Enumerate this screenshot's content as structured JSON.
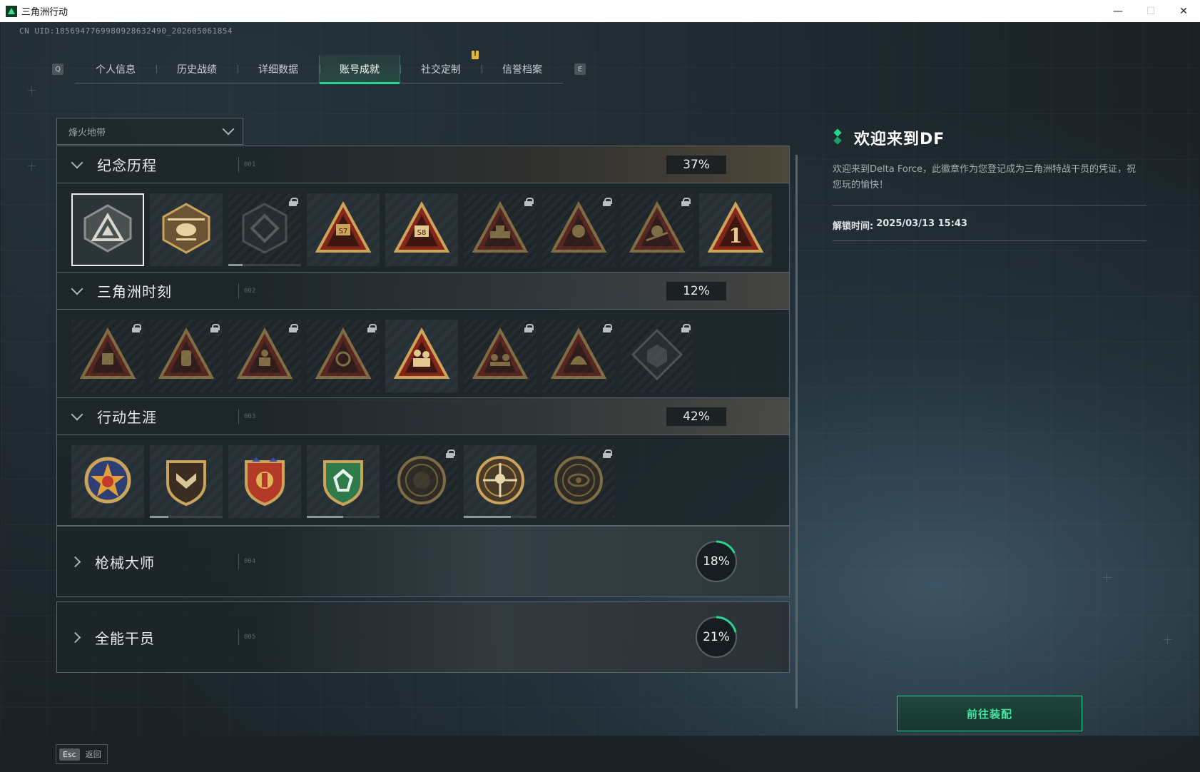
{
  "window": {
    "title": "三角洲行动",
    "minimize": "—",
    "maximize": "☐",
    "close": "✕"
  },
  "uid_text": "CN UID:1856947769980928632490_202605061854",
  "tabs": {
    "left_key": "Q",
    "right_key": "E",
    "items": [
      {
        "label": "个人信息"
      },
      {
        "label": "历史战绩"
      },
      {
        "label": "详细数据"
      },
      {
        "label": "账号成就"
      },
      {
        "label": "社交定制"
      },
      {
        "label": "信誉档案"
      }
    ],
    "active_index": 3,
    "notify_index": 4
  },
  "mode_select": {
    "value": "烽火地带"
  },
  "sections": [
    {
      "title": "纪念历程",
      "num": "001",
      "percent": "37%",
      "expanded": true
    },
    {
      "title": "三角洲时刻",
      "num": "002",
      "percent": "12%",
      "expanded": true
    },
    {
      "title": "行动生涯",
      "num": "003",
      "percent": "42%",
      "expanded": true
    },
    {
      "title": "枪械大师",
      "num": "004",
      "percent": "18%",
      "progress": 0.18,
      "expanded": false
    },
    {
      "title": "全能干员",
      "num": "005",
      "percent": "21%",
      "progress": 0.21,
      "expanded": false
    }
  ],
  "badge_rows": [
    {
      "section": "纪念历程",
      "badges": [
        {
          "icon": "delta-triangle-icon",
          "locked": false,
          "selected": true
        },
        {
          "icon": "helicopter-icon",
          "locked": false
        },
        {
          "icon": "hex-shield-icon",
          "locked": true,
          "progress": 0.2
        },
        {
          "icon": "s7-triangle-icon",
          "locked": false
        },
        {
          "icon": "s8-triangle-icon",
          "locked": false
        },
        {
          "icon": "tank-triangle-icon",
          "locked": true
        },
        {
          "icon": "operator-triangle-icon",
          "locked": true
        },
        {
          "icon": "skull-triangle-icon",
          "locked": true
        },
        {
          "icon": "rank-one-triangle-icon",
          "locked": false
        }
      ]
    },
    {
      "section": "三角洲时刻",
      "badges": [
        {
          "icon": "robot-triangle-icon",
          "locked": true
        },
        {
          "icon": "canister-triangle-icon",
          "locked": true
        },
        {
          "icon": "soldier-triangle-icon",
          "locked": true
        },
        {
          "icon": "medic-triangle-icon",
          "locked": true
        },
        {
          "icon": "carry-triangle-icon",
          "locked": false
        },
        {
          "icon": "squad-triangle-icon",
          "locked": true
        },
        {
          "icon": "beast-triangle-icon",
          "locked": true
        },
        {
          "icon": "cube-diamond-icon",
          "locked": true
        }
      ]
    },
    {
      "section": "行动生涯",
      "badges": [
        {
          "icon": "star-medal-icon",
          "locked": false
        },
        {
          "icon": "chevron-shield-icon",
          "locked": false,
          "progress": 0.25
        },
        {
          "icon": "winged-shield-icon",
          "locked": false
        },
        {
          "icon": "green-shield-icon",
          "locked": false,
          "progress": 0.5
        },
        {
          "icon": "ring-emblem-icon",
          "locked": true
        },
        {
          "icon": "crosshair-medal-icon",
          "locked": false,
          "progress": 0.65
        },
        {
          "icon": "eye-emblem-icon",
          "locked": true
        }
      ]
    }
  ],
  "detail": {
    "title": "欢迎来到DF",
    "description": "欢迎来到Delta Force，此徽章作为您登记成为三角洲特战干员的凭证，祝您玩的愉快！",
    "unlock_label": "解锁时间:",
    "unlock_time": "2025/03/13 15:43",
    "equip_button": "前往装配"
  },
  "bottom": {
    "esc_key": "Esc",
    "back_label": "返回"
  },
  "colors": {
    "accent": "#2bd48d",
    "badge_gold": "#c9a45a",
    "badge_red": "#8a2418"
  }
}
